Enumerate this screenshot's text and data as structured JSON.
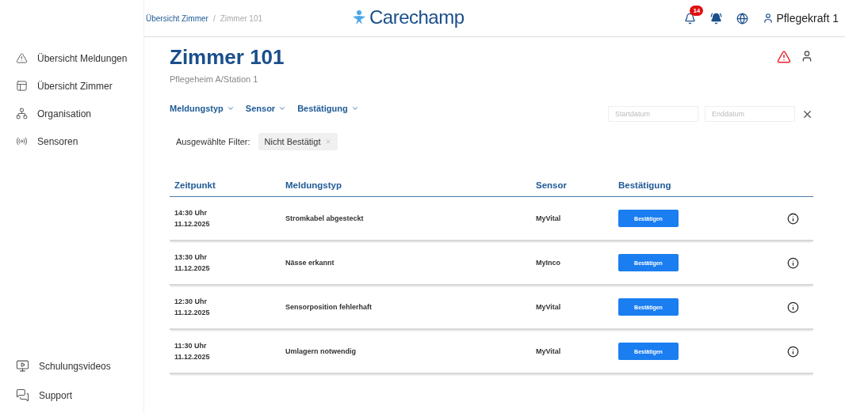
{
  "header": {
    "breadcrumb": [
      {
        "label": "Übersicht Zimmer",
        "current": false
      },
      {
        "label": "Zimmer 101",
        "current": true
      }
    ],
    "breadcrumb_separator": "/",
    "logo": "Carechamp",
    "notification_count": "14",
    "user": "Pflegekraft 1"
  },
  "sidebar": {
    "items": [
      {
        "label": "Übersicht Meldungen"
      },
      {
        "label": "Übersicht Zimmer"
      },
      {
        "label": "Organisation"
      },
      {
        "label": "Sensoren"
      }
    ],
    "bottom_items": [
      {
        "label": "Schulungsvideos"
      },
      {
        "label": "Support"
      }
    ]
  },
  "page": {
    "title": "Zimmer 101",
    "subtitle": "Pflegeheim A/Station 1",
    "filters": [
      {
        "label": "Meldungstyp"
      },
      {
        "label": "Sensor"
      },
      {
        "label": "Bestätigung"
      }
    ],
    "date_fields": [
      {
        "placeholder": "Startdatum"
      },
      {
        "placeholder": "Enddatum"
      }
    ],
    "selected_filters_label": "Ausgewählte Filter:",
    "chips": [
      {
        "label": "Nicht Bestätigt"
      }
    ]
  },
  "table": {
    "columns": [
      "Zeitpunkt",
      "Meldungstyp",
      "Sensor",
      "Bestätigung"
    ],
    "rows": [
      {
        "time": "14:30 Uhr",
        "date": "11.12.2025",
        "type": "Stromkabel abgesteckt",
        "sensor": "MyVital",
        "action": "Bestätigen"
      },
      {
        "time": "13:30 Uhr",
        "date": "11.12.2025",
        "type": "Nässe erkannt",
        "sensor": "MyInco",
        "action": "Bestätigen"
      },
      {
        "time": "12:30 Uhr",
        "date": "11.12.2025",
        "type": "Sensorposition fehlerhaft",
        "sensor": "MyVital",
        "action": "Bestätigen"
      },
      {
        "time": "11:30 Uhr",
        "date": "11.12.2025",
        "type": "Umlagern notwendig",
        "sensor": "MyVital",
        "action": "Bestätigen"
      }
    ]
  }
}
